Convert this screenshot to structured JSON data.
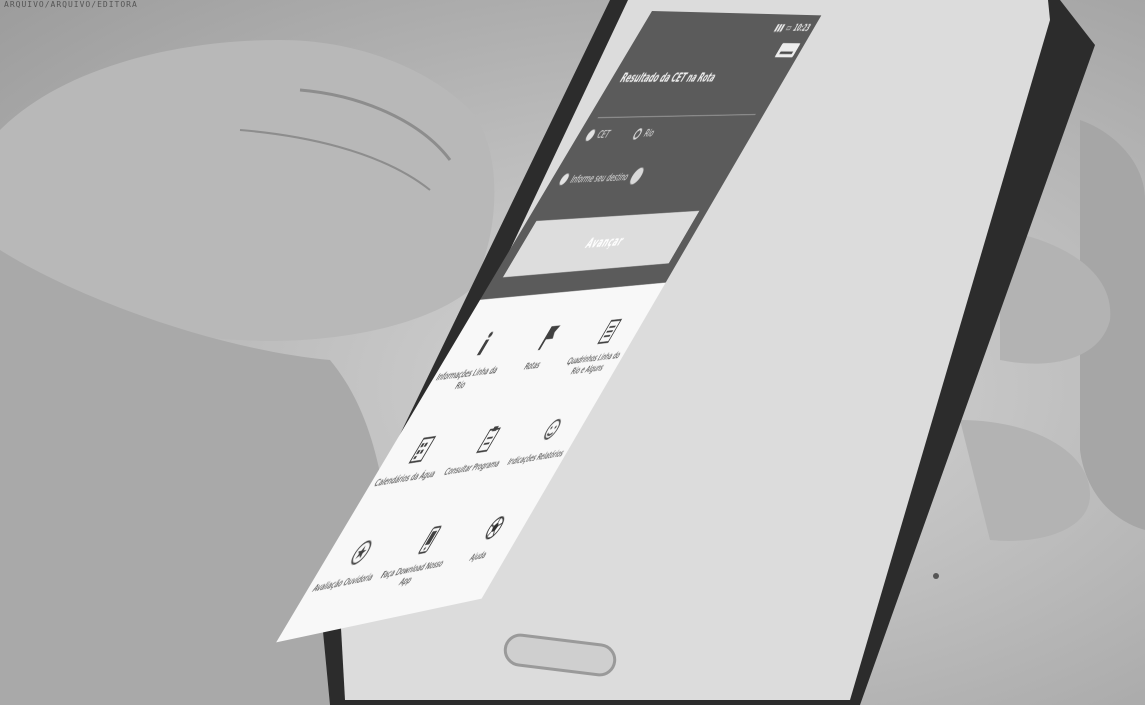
{
  "caption": "ARQUIVO/ARQUIVO/EDITORA",
  "status": {
    "time": "10:23"
  },
  "header": {
    "question": "Resultado da CET na Rota",
    "subtitle": "",
    "option1": "CET",
    "option2": "Rio",
    "option3": "Informe seu destino",
    "action": "Avançar"
  },
  "menu": [
    {
      "label": "Informações Linha da Rio",
      "icon": "info-icon"
    },
    {
      "label": "Rotas",
      "icon": "flag-icon"
    },
    {
      "label": "Quadrinhos Linha do Rio e Alguns",
      "icon": "document-icon"
    },
    {
      "label": "Calendários da Água",
      "icon": "calendar-icon"
    },
    {
      "label": "Consultar Programa",
      "icon": "clipboard-icon"
    },
    {
      "label": "Indicações Relatórios",
      "icon": "face-icon"
    },
    {
      "label": "Avaliação Ouvidoria",
      "icon": "star-icon"
    },
    {
      "label": "Faça Download Nosso App",
      "icon": "phone-icon"
    },
    {
      "label": "Ajuda",
      "icon": "ball-icon"
    }
  ]
}
